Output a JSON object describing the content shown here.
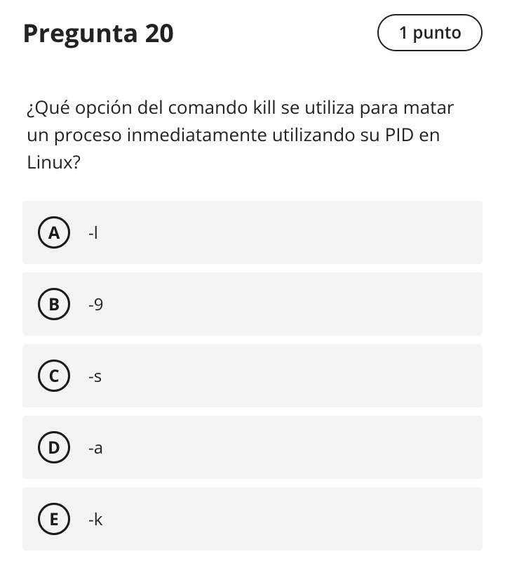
{
  "header": {
    "title": "Pregunta 20",
    "points": "1 punto"
  },
  "question": "¿Qué opción del comando kill se utiliza para matar un proceso inmediatamente utilizando su PID en Linux?",
  "options": [
    {
      "letter": "A",
      "text": "-l"
    },
    {
      "letter": "B",
      "text": "-9"
    },
    {
      "letter": "C",
      "text": "-s"
    },
    {
      "letter": "D",
      "text": "-a"
    },
    {
      "letter": "E",
      "text": "-k"
    }
  ]
}
